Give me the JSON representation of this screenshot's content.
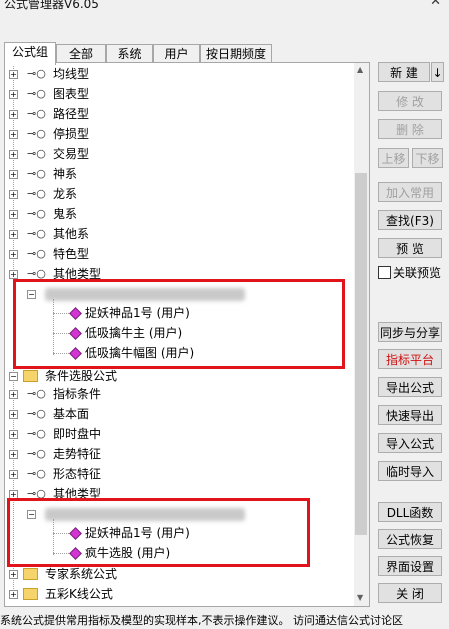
{
  "window": {
    "title": "公式管理器V6.05",
    "close": "✕"
  },
  "tabs": [
    "公式组",
    "全部",
    "系统",
    "用户",
    "按日期频度"
  ],
  "tree": {
    "items_a": [
      "均线型",
      "图表型",
      "路径型",
      "停损型",
      "交易型",
      "神系",
      "龙系",
      "鬼系",
      "其他系",
      "特色型",
      "其他类型"
    ],
    "group1_items": [
      "捉妖神品1号 (用户)",
      "低吸擒牛主 (用户)",
      "低吸擒牛幅图 (用户)"
    ],
    "condition_folder": "条件选股公式",
    "items_b": [
      "指标条件",
      "基本面",
      "即时盘中",
      "走势特征",
      "形态特征",
      "其他类型"
    ],
    "group2_items": [
      "捉妖神品1号 (用户)",
      "疯牛选股 (用户)"
    ],
    "folders_bottom": [
      "专家系统公式",
      "五彩K线公式"
    ]
  },
  "buttons": {
    "new": "新 建",
    "new_arrow": "↓",
    "modify": "修 改",
    "delete": "删 除",
    "move_up": "上移",
    "move_down": "下移",
    "add_common": "加入常用",
    "find": "查找(F3)",
    "preview": "预 览",
    "link_preview": "关联预览",
    "sync_share": "同步与分享",
    "indicator_platform": "指标平台",
    "export": "导出公式",
    "quick_export": "快速导出",
    "import": "导入公式",
    "temp_import": "临时导入",
    "dll": "DLL函数",
    "restore": "公式恢复",
    "interface": "界面设置",
    "close": "关 闭"
  },
  "status": "系统公式提供常用指标及模型的实现样本,不表示操作建议。 访问通达信公式讨论区",
  "colors": {
    "highlight_box": "#e2141b",
    "indicator_platform_text": "#d01010"
  }
}
